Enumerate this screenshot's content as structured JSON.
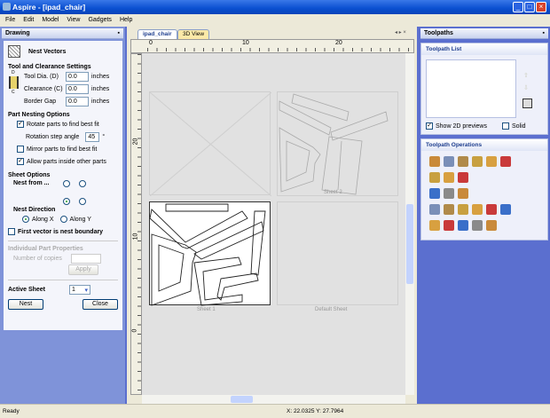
{
  "window": {
    "title": "Aspire - [ipad_chair]"
  },
  "menu": [
    "File",
    "Edit",
    "Model",
    "View",
    "Gadgets",
    "Help"
  ],
  "left_panel": {
    "header": "Drawing",
    "pin": "▪",
    "title": "Nest Vectors",
    "tool_section": "Tool and Clearance Settings",
    "tool_dia_label": "Tool Dia. (D)",
    "tool_dia": "0.0",
    "unit": "inches",
    "clearance_label": "Clearance (C)",
    "clearance": "0.0",
    "border_label": "Border Gap",
    "border": "0.0",
    "diagram_d": "D",
    "diagram_c": "C",
    "nesting_section": "Part Nesting Options",
    "rotate_label": "Rotate parts to find best fit",
    "rotate_checked": true,
    "rotation_step_label": "Rotation step angle",
    "rotation_step": "45",
    "degree": "°",
    "mirror_label": "Mirror parts to find best fit",
    "mirror_checked": false,
    "allow_inside_label": "Allow parts inside other parts",
    "allow_inside_checked": true,
    "sheet_section": "Sheet Options",
    "nest_from_label": "Nest from ...",
    "nest_direction_label": "Nest Direction",
    "along_x": "Along X",
    "along_y": "Along Y",
    "first_vector_label": "First vector is nest boundary",
    "part_props_section": "Individual Part Properties",
    "copies_label": "Number of copies",
    "apply": "Apply",
    "active_sheet_label": "Active Sheet",
    "active_sheet": "1",
    "nest_button": "Nest",
    "close_button": "Close"
  },
  "center": {
    "tabs": [
      "ipad_chair",
      "3D View"
    ],
    "ruler_top": [
      "0",
      "10",
      "20"
    ],
    "ruler_left": [
      "20",
      "10",
      "0"
    ],
    "sheets": [
      "Sheet 2",
      "Sheet 1",
      "Default Sheet"
    ]
  },
  "right_panel": {
    "header": "Toolpaths",
    "toolpath_list": "Toolpath List",
    "show_2d_label": "Show 2D previews",
    "show_2d_checked": true,
    "solid_label": "Solid",
    "operations": "Toolpath Operations",
    "op_icons": [
      [
        "profile-icon",
        "pocket-icon",
        "drill-icon",
        "vcarve-icon",
        "fluting-icon",
        "folder-icon"
      ],
      [
        "3d-roughing-icon",
        "3d-finishing-icon",
        "texture-icon"
      ],
      [
        "moulding-icon",
        "prism-icon",
        "inlay-icon"
      ],
      [
        "tool-database-icon",
        "edit-toolpath-icon",
        "merge-icon",
        "delete-icon",
        "simulate-icon",
        "save-toolpath-icon"
      ],
      [
        "material-icon",
        "sheet-icon",
        "origin-icon",
        "anchor-icon",
        "template-icon"
      ]
    ]
  },
  "status": {
    "left": "Ready",
    "coords": "X: 22.0325 Y: 27.7964"
  },
  "colors": {
    "title": "#0a4fd0",
    "panel": "#5b6fcf",
    "canvas": "#e1e1e1"
  }
}
